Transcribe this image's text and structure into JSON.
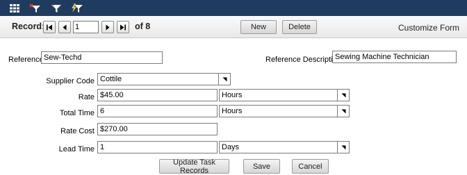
{
  "toolbar": {
    "icons": [
      "grid-icon",
      "filter-clear-icon",
      "filter-icon",
      "filter-lightning-icon"
    ]
  },
  "nav": {
    "record_label": "Record:",
    "current_record": "1",
    "of_label": "of 8",
    "new_label": "New",
    "delete_label": "Delete",
    "customize_label": "Customize Form"
  },
  "form": {
    "reference": {
      "label": "Reference",
      "value": "Sew-Techd"
    },
    "reference_description": {
      "label": "Reference Description",
      "value": "Sewing Machine Technician"
    },
    "supplier_code": {
      "label": "Supplier Code",
      "value": "Cottile"
    },
    "rate": {
      "label": "Rate",
      "value": "$45.00",
      "unit": "Hours"
    },
    "total_time": {
      "label": "Total Time",
      "value": "6",
      "unit": "Hours"
    },
    "rate_cost": {
      "label": "Rate Cost",
      "value": "$270.00"
    },
    "lead_time": {
      "label": "Lead Time",
      "value": "1",
      "unit": "Days"
    }
  },
  "actions": {
    "update_label": "Update Task Records",
    "save_label": "Save",
    "cancel_label": "Cancel"
  },
  "colors": {
    "topbar": "#1f3b5f",
    "icon_accent": "#f2c12e"
  }
}
